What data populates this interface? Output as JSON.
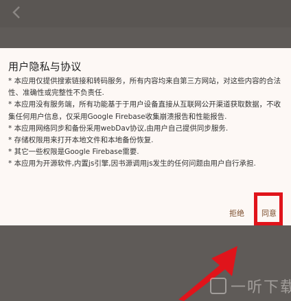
{
  "dialog": {
    "title": "用户隐私与协议",
    "paragraphs": [
      "* 本应用仅提供搜索链接和转码服务，所有内容均来自第三方网站，对这些内容的合法性、准确性或完整性不负责任.",
      "* 本应用没有服务端，所有功能基于于用户设备直接从互联网公开渠道获取数据，不收集任何用户信息，仅采用Google Firebase收集崩溃报告和性能报告.",
      "* 本应用网络同步和备份采用webDav协议,由用户自己提供同步服务.",
      "* 存储权限用来打开本地文件和本地备份恢复.",
      "* 其它一些权限是Google Firebase需要.",
      "* 本应用为开源软件,内置js引擎,因书源调用js发生的任何问题由用户自行承担."
    ],
    "reject_label": "拒绝",
    "agree_label": "同意"
  },
  "watermark": {
    "text": "一听下载"
  },
  "colors": {
    "background": "#5f5b58",
    "dialog": "#fdf8f5",
    "accent_button": "#7a4b2a",
    "highlight": "#e0141b"
  }
}
